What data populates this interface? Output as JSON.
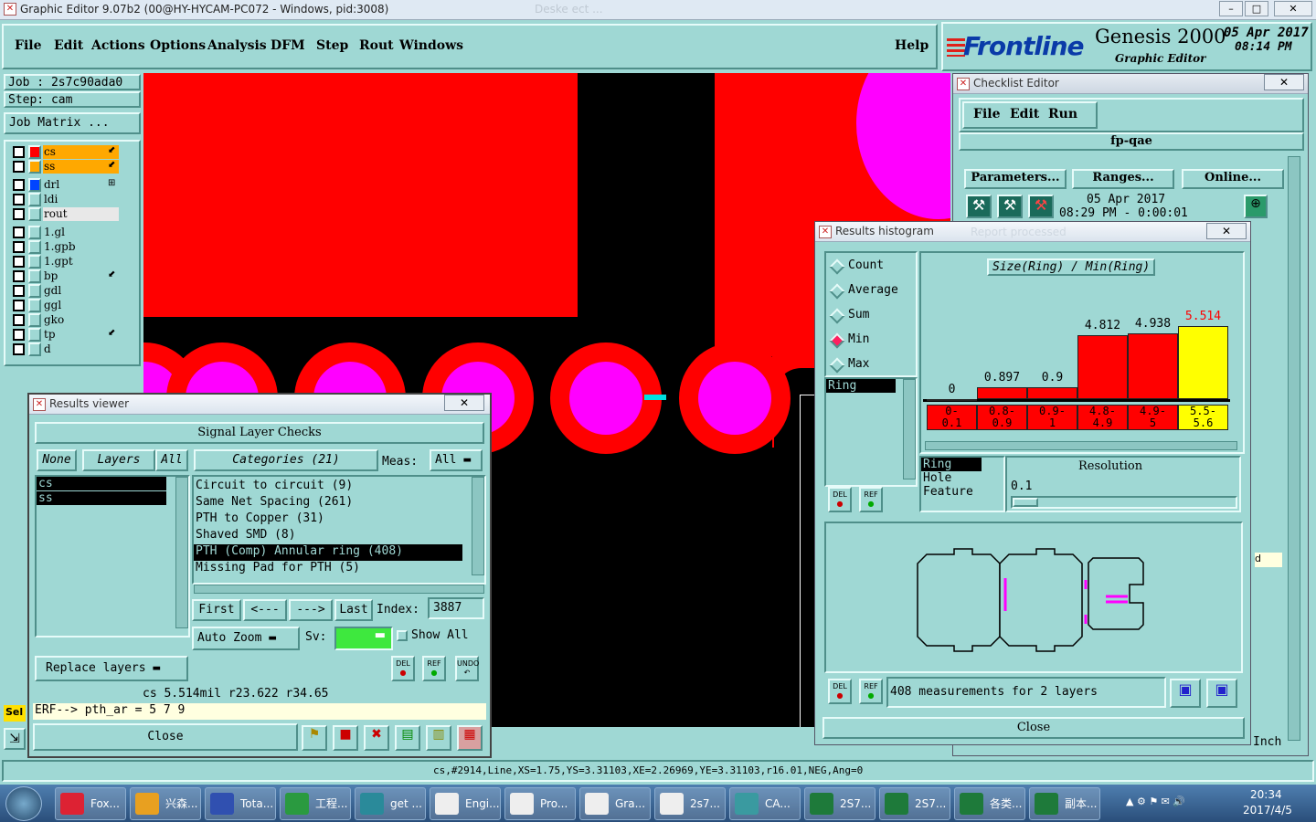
{
  "window": {
    "title": "Graphic Editor 9.07b2 (00@HY-HYCAM-PC072 - Windows, pid:3008)",
    "ghost": "Deske ect ...",
    "min": "–",
    "max": "□",
    "close": "✕"
  },
  "menu": [
    "File",
    "Edit",
    "Actions",
    "Options",
    "Analysis",
    "DFM",
    "Step",
    "Rout",
    "Windows"
  ],
  "help": "Help",
  "brand": {
    "logo": "Frontline",
    "product": "Genesis 2000",
    "subtitle": "Graphic Editor",
    "date": "05 Apr 2017",
    "time": "08:14 PM"
  },
  "job": {
    "job": "Job : 2s7c90ada0",
    "step": "Step: cam",
    "matrix": "Job Matrix ..."
  },
  "layers": [
    {
      "name": "cs",
      "color": "#ff0000",
      "bg": "#ffa800",
      "mark": "⬋"
    },
    {
      "name": "ss",
      "color": "#ffa800",
      "bg": "#ffa800",
      "mark": "⬋"
    },
    {
      "name": "drl",
      "color": "#0044ff",
      "bg": "#9fd8d4",
      "mark": "⊞"
    },
    {
      "name": "ldi",
      "color": "#9fd8d4",
      "bg": "#9fd8d4",
      "mark": ""
    },
    {
      "name": "rout",
      "color": "#9fd8d4",
      "bg": "#e8e8e8",
      "mark": ""
    },
    {
      "name": "1.gl",
      "color": "#9fd8d4",
      "bg": "#9fd8d4",
      "mark": ""
    },
    {
      "name": "1.gpb",
      "color": "#9fd8d4",
      "bg": "#9fd8d4",
      "mark": ""
    },
    {
      "name": "1.gpt",
      "color": "#9fd8d4",
      "bg": "#9fd8d4",
      "mark": ""
    },
    {
      "name": "bp",
      "color": "#9fd8d4",
      "bg": "#9fd8d4",
      "mark": "⬋"
    },
    {
      "name": "gdl",
      "color": "#9fd8d4",
      "bg": "#9fd8d4",
      "mark": ""
    },
    {
      "name": "ggl",
      "color": "#9fd8d4",
      "bg": "#9fd8d4",
      "mark": ""
    },
    {
      "name": "gko",
      "color": "#9fd8d4",
      "bg": "#9fd8d4",
      "mark": ""
    },
    {
      "name": "tp",
      "color": "#9fd8d4",
      "bg": "#9fd8d4",
      "mark": "⬋"
    },
    {
      "name": "d",
      "color": "#9fd8d4",
      "bg": "#9fd8d4",
      "mark": ""
    }
  ],
  "checklist": {
    "title": "Checklist Editor",
    "menu": [
      "File",
      "Edit",
      "Run"
    ],
    "name": "fp-qae",
    "params": "Parameters...",
    "ranges": "Ranges...",
    "online": "Online...",
    "date": "05 Apr 2017",
    "time": "08:29 PM - 0:00:01",
    "side_label": "d",
    "units": "Inch"
  },
  "histogram": {
    "title": "Results histogram",
    "ghost": "Report processed",
    "options": [
      "Count",
      "Average",
      "Sum",
      "Min",
      "Max"
    ],
    "selected_option": "Min",
    "chart_title": "Size(Ring) / Min(Ring)",
    "list": [
      "Ring"
    ],
    "types": [
      "Ring",
      "Hole",
      "Feature"
    ],
    "resolution_label": "Resolution",
    "resolution": "0.1",
    "status": "408 measurements for 2 layers",
    "close": "Close",
    "del": "DEL",
    "ref": "REF"
  },
  "chart_data": {
    "type": "bar",
    "title": "Size(Ring) / Min(Ring)",
    "categories": [
      "0-\n0.1",
      "0.8-\n0.9",
      "0.9-\n1",
      "4.8-\n4.9",
      "4.9-\n5",
      "5.5-\n5.6"
    ],
    "values": [
      0,
      0.897,
      0.9,
      4.812,
      4.938,
      5.514
    ],
    "labels": [
      "0",
      "0.897",
      "0.9",
      "4.812",
      "4.938",
      "5.514"
    ],
    "highlight_index": 5,
    "colors": {
      "bar": "#ff0000",
      "highlight": "#ffff00",
      "label_highlight": "#ff0000"
    }
  },
  "results": {
    "title": "Results viewer",
    "header": "Signal Layer Checks",
    "none": "None",
    "layers_btn": "Layers",
    "all": "All",
    "categories_btn": "Categories (21)",
    "meas_label": "Meas:",
    "meas_value": "All",
    "layer_list": [
      "cs",
      "ss"
    ],
    "categories": [
      "Circuit to circuit (9)",
      "Same Net Spacing (261)",
      "PTH to Copper (31)",
      "Shaved SMD (8)",
      "PTH (Comp) Annular ring (408)",
      "Missing Pad for PTH (5)"
    ],
    "selected_category": 4,
    "first": "First",
    "prev": "<---",
    "next": "--->",
    "last": "Last",
    "index_label": "Index:",
    "index_value": "3887",
    "zoom": "Auto Zoom",
    "sv": "Sv:",
    "show_all": "Show All",
    "replace": "Replace layers",
    "info": "cs 5.514mil  r23.622  r34.65",
    "erf": "ERF--> pth_ar = 5 7 9",
    "close": "Close",
    "del": "DEL",
    "ref": "REF",
    "undo": "UNDO",
    "sel": "Sel"
  },
  "statusline": "cs,#2914,Line,XS=1.75,YS=3.31103,XE=2.26969,YE=3.31103,r16.01,NEG,Ang=0",
  "taskbar": {
    "apps": [
      {
        "label": "Fox...",
        "color": "#d23"
      },
      {
        "label": "兴森...",
        "color": "#e8a020"
      },
      {
        "label": "Tota...",
        "color": "#3050b0"
      },
      {
        "label": "工程...",
        "color": "#2a9a40"
      },
      {
        "label": "get ...",
        "color": "#2a8a9a"
      },
      {
        "label": "Engi...",
        "color": "#eee"
      },
      {
        "label": "Pro...",
        "color": "#eee"
      },
      {
        "label": "Gra...",
        "color": "#eee"
      },
      {
        "label": "2s7...",
        "color": "#eee"
      },
      {
        "label": "CA...",
        "color": "#3a9aa0"
      },
      {
        "label": "2S7...",
        "color": "#1e7a3a"
      },
      {
        "label": "2S7...",
        "color": "#1e7a3a"
      },
      {
        "label": "各类...",
        "color": "#1e7a3a"
      },
      {
        "label": "副本...",
        "color": "#1e7a3a"
      }
    ],
    "time": "20:34",
    "date": "2017/4/5"
  }
}
